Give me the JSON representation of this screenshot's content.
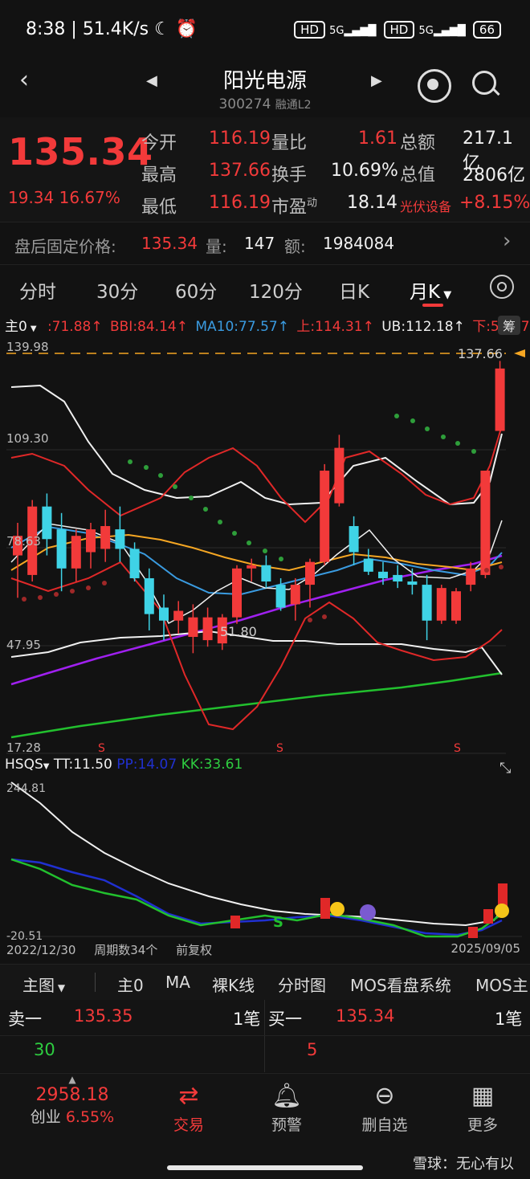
{
  "status_bar": {
    "time": "8:38",
    "speed": "51.4K/s",
    "battery": "66",
    "net1": "5G",
    "net2": "5G",
    "hd1": "HD",
    "hd2": "HD"
  },
  "header": {
    "title": "阳光电源",
    "code": "300274",
    "tags": "融通L2"
  },
  "quote": {
    "price": "135.34",
    "change": "19.34",
    "change_pct": "16.67%",
    "open_label": "今开",
    "open": "116.19",
    "high_label": "最高",
    "high": "137.66",
    "low_label": "最低",
    "low": "116.19",
    "vol_ratio_label": "量比",
    "vol_ratio": "1.61",
    "turnover_label": "换手",
    "turnover": "10.69%",
    "pe_label": "市盈",
    "pe_sup": "动",
    "pe": "18.14",
    "amount_label": "总额",
    "amount": "217.1亿",
    "mktcap_label": "总值",
    "mktcap": "2806亿",
    "sector": "光伏设备",
    "sector_chg": "+8.15%"
  },
  "after_hours": {
    "label": "盘后固定价格:",
    "price": "135.34",
    "vol_label": "量:",
    "vol": "147",
    "amt_label": "额:",
    "amt": "1984084"
  },
  "tabs": [
    "分时",
    "30分",
    "60分",
    "120分",
    "日K",
    "月K"
  ],
  "legend": {
    "main": "主0",
    "v1": ":71.88↑",
    "bbi": "BBI:84.14↑",
    "ma10": "MA10:77.57↑",
    "up": "上:114.31↑",
    "ub": "UB:112.18↑",
    "down": "下:53.97↑",
    "chip": "筹"
  },
  "price_axis": {
    "top": "139.98",
    "l2": "109.30",
    "l3": "78.63",
    "l4": "47.95",
    "bottom": "17.28",
    "high_mark": "137.66",
    "low_mark": "51.80",
    "s_mark": "S"
  },
  "hsqs": {
    "name": "HSQS",
    "tt": "TT:11.50",
    "pp": "PP:14.07",
    "kk": "KK:33.61",
    "top": "244.81",
    "bottom": "-20.51",
    "s_mark": "S"
  },
  "bottom_axis": {
    "start": "2022/12/30",
    "periods": "周期数34个",
    "adj": "前复权",
    "end": "2025/09/05"
  },
  "indicators": {
    "main_label": "主图",
    "items": [
      "主0",
      "MA",
      "裸K线",
      "分时图",
      "MOS看盘系统",
      "MOS主"
    ]
  },
  "order_book": {
    "sell_label": "卖一",
    "sell_price": "135.35",
    "sell_count": "1笔",
    "sell_vol": "30",
    "buy_label": "买一",
    "buy_price": "135.34",
    "buy_count": "1笔",
    "buy_vol": "5"
  },
  "bottom_bar": {
    "index_value": "2958.18",
    "index_name": "创业",
    "index_chg": "6.55%",
    "trade": "交易",
    "alert": "预警",
    "remove": "删自选",
    "more": "更多"
  },
  "watermark": "雪球：无心有以",
  "colors": {
    "up": "#f23a3a",
    "down": "#3fd3e6",
    "ma_orange": "#f5a623",
    "ma_purple": "#a020f0",
    "ma_green": "#22c02e",
    "ma_blue": "#3a9be0"
  },
  "chart_data": {
    "type": "candlestick",
    "ylim": [
      17.28,
      139.98
    ],
    "candles": [
      {
        "o": 78,
        "h": 88,
        "l": 65,
        "c": 84
      },
      {
        "o": 72,
        "h": 95,
        "l": 70,
        "c": 93
      },
      {
        "o": 93,
        "h": 97,
        "l": 78,
        "c": 83
      },
      {
        "o": 86,
        "h": 91,
        "l": 67,
        "c": 74
      },
      {
        "o": 74,
        "h": 86,
        "l": 70,
        "c": 84
      },
      {
        "o": 79,
        "h": 88,
        "l": 74,
        "c": 86
      },
      {
        "o": 80,
        "h": 92,
        "l": 76,
        "c": 87
      },
      {
        "o": 86,
        "h": 93,
        "l": 76,
        "c": 80
      },
      {
        "o": 80,
        "h": 82,
        "l": 70,
        "c": 71
      },
      {
        "o": 71,
        "h": 74,
        "l": 55,
        "c": 60
      },
      {
        "o": 62,
        "h": 66,
        "l": 52,
        "c": 58
      },
      {
        "o": 58,
        "h": 64,
        "l": 54,
        "c": 61
      },
      {
        "o": 53,
        "h": 63,
        "l": 48,
        "c": 59
      },
      {
        "o": 52,
        "h": 62,
        "l": 50,
        "c": 59
      },
      {
        "o": 51,
        "h": 60,
        "l": 49,
        "c": 59
      },
      {
        "o": 59,
        "h": 75,
        "l": 57,
        "c": 74
      },
      {
        "o": 74,
        "h": 77,
        "l": 70,
        "c": 75
      },
      {
        "o": 75,
        "h": 78,
        "l": 68,
        "c": 70
      },
      {
        "o": 69,
        "h": 71,
        "l": 61,
        "c": 62
      },
      {
        "o": 63,
        "h": 71,
        "l": 58,
        "c": 69
      },
      {
        "o": 69,
        "h": 77,
        "l": 62,
        "c": 76
      },
      {
        "o": 76,
        "h": 106,
        "l": 75,
        "c": 104
      },
      {
        "o": 94,
        "h": 115,
        "l": 93,
        "c": 111
      },
      {
        "o": 87,
        "h": 90,
        "l": 75,
        "c": 79
      },
      {
        "o": 77,
        "h": 80,
        "l": 72,
        "c": 73
      },
      {
        "o": 73,
        "h": 76,
        "l": 69,
        "c": 71
      },
      {
        "o": 72,
        "h": 75,
        "l": 68,
        "c": 70
      },
      {
        "o": 70,
        "h": 74,
        "l": 66,
        "c": 69
      },
      {
        "o": 69,
        "h": 72,
        "l": 52,
        "c": 58
      },
      {
        "o": 58,
        "h": 69,
        "l": 57,
        "c": 68
      },
      {
        "o": 58,
        "h": 68,
        "l": 57,
        "c": 67
      },
      {
        "o": 69,
        "h": 76,
        "l": 67,
        "c": 74
      },
      {
        "o": 72,
        "h": 104,
        "l": 71,
        "c": 104
      },
      {
        "o": 116.19,
        "h": 137.66,
        "l": 116.19,
        "c": 135.34
      }
    ]
  }
}
